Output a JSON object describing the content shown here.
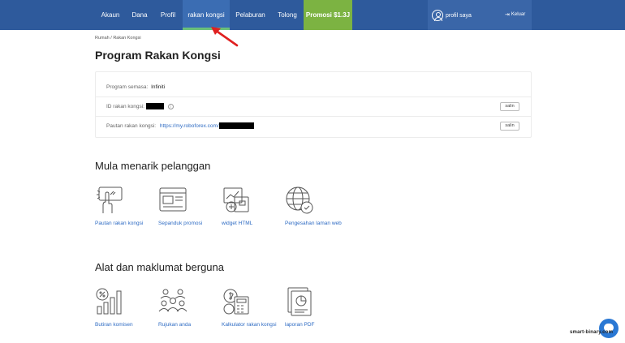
{
  "nav": {
    "items": [
      {
        "label": "Akaun"
      },
      {
        "label": "Dana"
      },
      {
        "label": "Profil"
      },
      {
        "label": "rakan kongsi"
      },
      {
        "label": "Pelaburan"
      },
      {
        "label": "Tolong"
      },
      {
        "label": "Promosi $1.3J"
      }
    ],
    "active_index": 3,
    "profile_label": "profil saya",
    "logout_label": "Keluar"
  },
  "breadcrumb": {
    "home": "Rumah",
    "separator": " / ",
    "current": "Rakan Kongsi"
  },
  "page_title": "Program Rakan Kongsi",
  "info_card": {
    "program_label": "Program semasa:",
    "program_value": "Infiniti",
    "id_label": "ID rakan kongsi:",
    "link_label": "Pautan rakan kongsi:",
    "link_value": "https://my.roboforex.com/",
    "copy_label": "salin"
  },
  "section_attract": {
    "title": "Mula menarik pelanggan",
    "items": [
      {
        "label": "Pautan rakan kongsi",
        "icon": "hand-touch-icon"
      },
      {
        "label": "Sepanduk promosi",
        "icon": "banner-icon"
      },
      {
        "label": "widget HTML",
        "icon": "widget-icon"
      },
      {
        "label": "Pengesahan laman web",
        "icon": "globe-check-icon"
      }
    ]
  },
  "section_tools": {
    "title": "Alat dan maklumat berguna",
    "items": [
      {
        "label": "Butiran komisen",
        "icon": "percent-chart-icon"
      },
      {
        "label": "Rujukan anda",
        "icon": "people-icon"
      },
      {
        "label": "Kalkulator rakan kongsi",
        "icon": "calculator-icon"
      },
      {
        "label": "laporan PDF",
        "icon": "pdf-report-icon"
      }
    ]
  },
  "watermark": "smart-binary.com",
  "colors": {
    "nav_bg": "#2e5a9c",
    "nav_active": "#3b6db3",
    "promo": "#7cb342",
    "link": "#2e6bc3",
    "arrow": "#e02020"
  }
}
